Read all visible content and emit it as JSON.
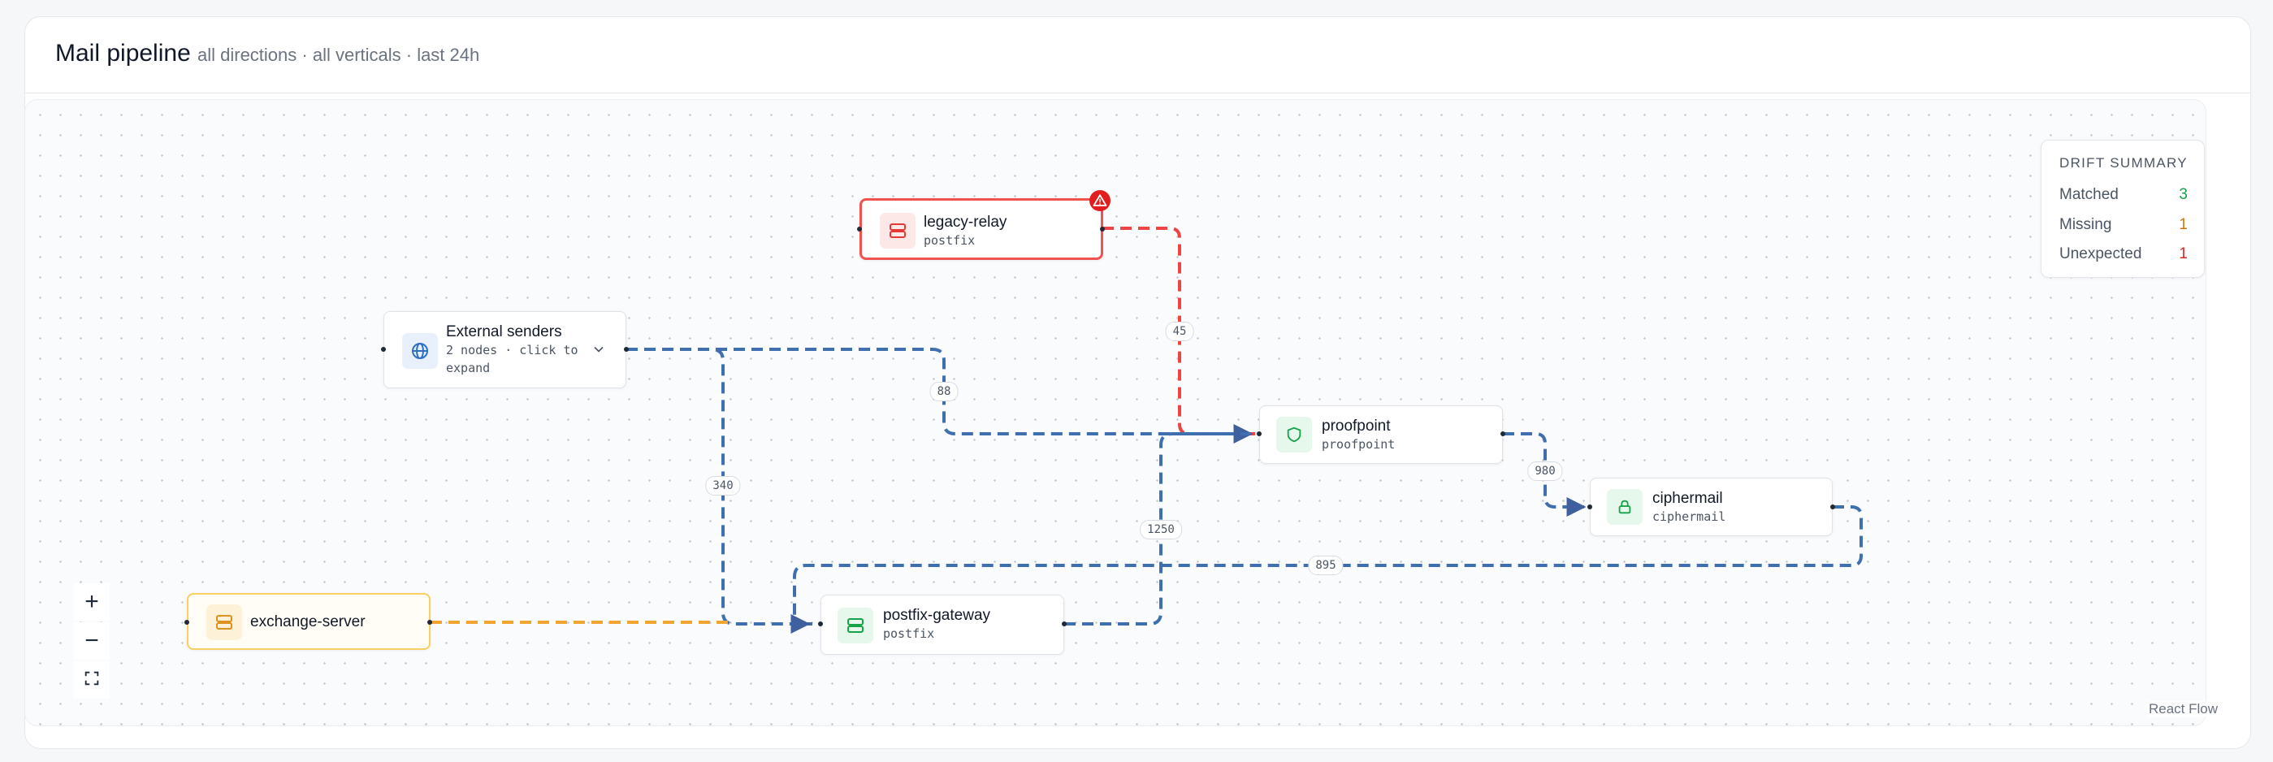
{
  "header": {
    "title": "Mail pipeline",
    "subtitle": "all directions · all verticals · last 24h"
  },
  "colors": {
    "edge_blue": "#3f6fae",
    "edge_red": "#ef4444",
    "edge_amber": "#f0a530",
    "node_red_border": "#ef5350",
    "node_amber_border": "#f7cf63",
    "matched": "#16a34a",
    "missing": "#d97706",
    "unexpected": "#dc2626"
  },
  "nodes": {
    "legacy_relay": {
      "label": "legacy-relay",
      "sub": "postfix",
      "icon": "server-icon",
      "status": "error"
    },
    "external_senders": {
      "label": "External senders",
      "sub_line1": "2 nodes · click to",
      "sub_line2": "expand",
      "icon": "globe-icon"
    },
    "proofpoint": {
      "label": "proofpoint",
      "sub": "proofpoint",
      "icon": "shield-icon"
    },
    "ciphermail": {
      "label": "ciphermail",
      "sub": "ciphermail",
      "icon": "lock-icon"
    },
    "exchange_server": {
      "label": "exchange-server",
      "icon": "server-icon",
      "status": "warning"
    },
    "postfix_gateway": {
      "label": "postfix-gateway",
      "sub": "postfix",
      "icon": "server-icon"
    }
  },
  "edges": [
    {
      "from": "legacy-relay",
      "to": "proofpoint",
      "label": "45",
      "color": "red"
    },
    {
      "from": "External senders",
      "to": "proofpoint",
      "label": "88",
      "color": "blue"
    },
    {
      "from": "External senders",
      "to": "postfix-gateway",
      "label": "340",
      "color": "blue"
    },
    {
      "from": "postfix-gateway",
      "to": "proofpoint",
      "label": "1250",
      "color": "blue"
    },
    {
      "from": "proofpoint",
      "to": "ciphermail",
      "label": "980",
      "color": "blue"
    },
    {
      "from": "ciphermail",
      "to": "postfix-gateway",
      "label": "895",
      "color": "blue"
    },
    {
      "from": "exchange-server",
      "to": "postfix-gateway",
      "label": "",
      "color": "amber"
    }
  ],
  "drift_summary": {
    "title": "DRIFT SUMMARY",
    "rows": [
      {
        "label": "Matched",
        "value": "3"
      },
      {
        "label": "Missing",
        "value": "1"
      },
      {
        "label": "Unexpected",
        "value": "1"
      }
    ]
  },
  "controls": {
    "zoom_in": "+",
    "zoom_out": "−",
    "fit_icon": "fit-view-icon"
  },
  "attribution": "React Flow"
}
